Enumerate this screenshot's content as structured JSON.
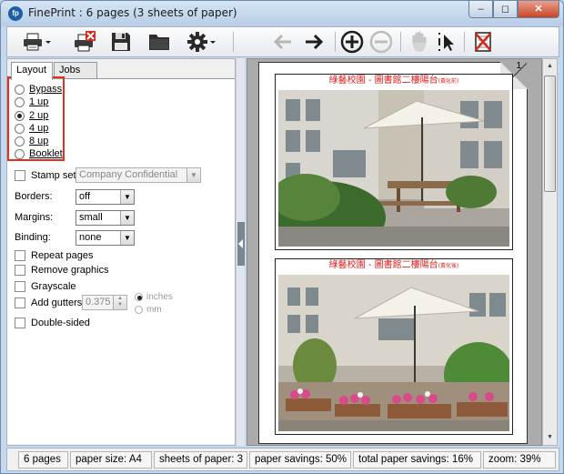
{
  "window": {
    "title": "FinePrint : 6 pages (3 sheets of paper)",
    "app_icon": "fp",
    "minimize": "–",
    "maximize": "◻",
    "close": "✕"
  },
  "toolbar": {
    "icons": [
      "printer-dropdown-icon",
      "printer-delete-icon",
      "save-icon",
      "folder-icon",
      "gear-dropdown-icon",
      "back-arrow-icon",
      "forward-arrow-icon",
      "zoom-in-icon",
      "zoom-out-icon",
      "hand-pan-icon",
      "select-cursor-icon",
      "delete-page-icon"
    ]
  },
  "tabs": {
    "layout": "Layout",
    "jobs": "Jobs"
  },
  "layout_options": [
    {
      "label": "Bypass",
      "selected": false
    },
    {
      "label": "1 up",
      "selected": false
    },
    {
      "label": "2 up",
      "selected": true
    },
    {
      "label": "4 up",
      "selected": false
    },
    {
      "label": "8 up",
      "selected": false
    },
    {
      "label": "Booklet",
      "selected": false
    }
  ],
  "stamp": {
    "label": "Stamp set:",
    "value": "Company Confidential"
  },
  "borders": {
    "label": "Borders:",
    "value": "off"
  },
  "margins": {
    "label": "Margins:",
    "value": "small"
  },
  "binding": {
    "label": "Binding:",
    "value": "none"
  },
  "checkboxes": {
    "repeat_pages": "Repeat pages",
    "remove_graphics": "Remove graphics",
    "grayscale": "Grayscale",
    "add_gutters": "Add gutters",
    "double_sided": "Double-sided"
  },
  "gutter": {
    "value": "0.375",
    "unit_inches": "inches",
    "unit_mm": "mm"
  },
  "preview": {
    "page_number": "1",
    "sheets": [
      {
        "caption": "綠藝校園 - 圖書館二樓陽台",
        "caption_small": "(黃化前)"
      },
      {
        "caption": "綠藝校園 - 圖書館二樓陽台",
        "caption_small": "(黃化後)"
      }
    ]
  },
  "status": {
    "pages": "6 pages",
    "paper_size": "paper size: A4",
    "sheets": "sheets of paper: 3",
    "savings": "paper savings: 50%",
    "total_savings": "total paper savings: 16%",
    "zoom": "zoom: 39%"
  },
  "colors": {
    "highlight": "#e0301e",
    "caption_red": "#e21b1b",
    "titlebar": "#c5d9ee"
  }
}
